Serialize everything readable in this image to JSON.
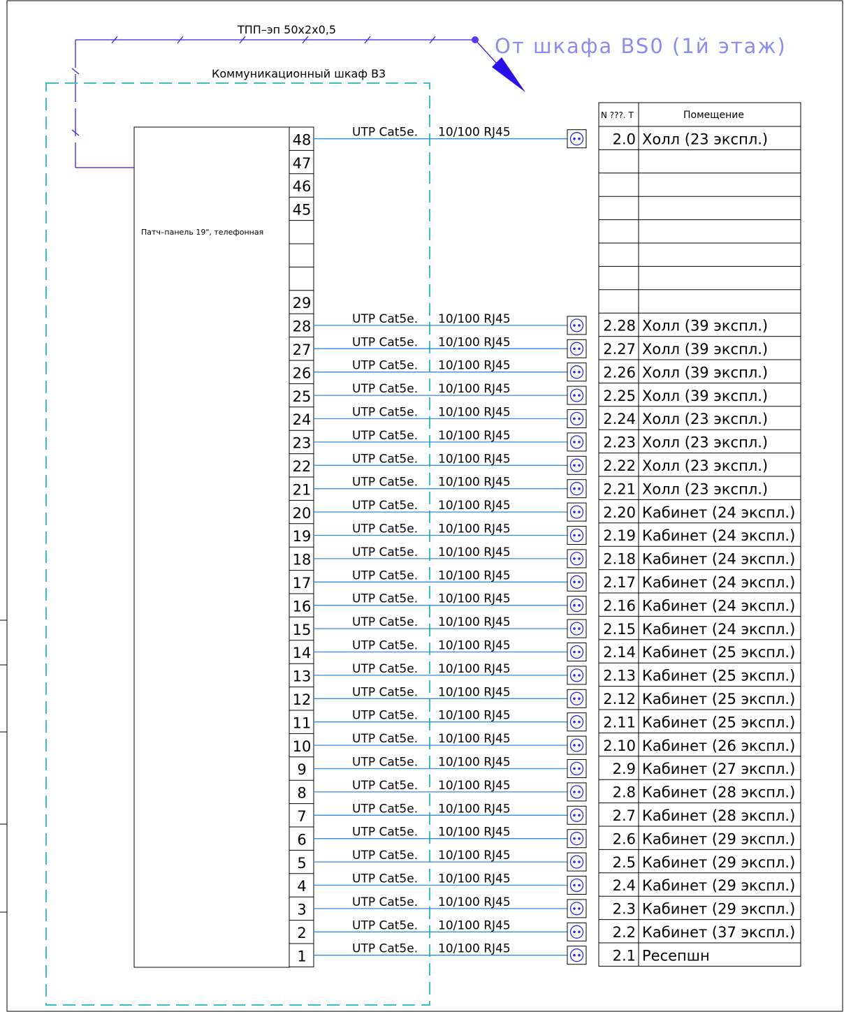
{
  "texts": {
    "trunk_cable": "ТПП–эп 50x2x0,5",
    "source": "От шкафа BS0 (1й этаж)",
    "cabinet": "Коммуникационный шкаф В3",
    "panel": "Патч–панель 19\", телефонная"
  },
  "table_headers": {
    "number": "N ???. T",
    "room": "Помещение"
  },
  "cable_label": {
    "cable": "UTP Cat5e.",
    "type": "10/100 RJ45"
  },
  "upper_ports": [
    "48",
    "47",
    "46",
    "45",
    "",
    "",
    "",
    "29"
  ],
  "rows": [
    {
      "port": "28",
      "num": "2.28",
      "room": "Холл (39 экспл.)"
    },
    {
      "port": "27",
      "num": "2.27",
      "room": "Холл (39 экспл.)"
    },
    {
      "port": "26",
      "num": "2.26",
      "room": "Холл (39 экспл.)"
    },
    {
      "port": "25",
      "num": "2.25",
      "room": "Холл (39 экспл.)"
    },
    {
      "port": "24",
      "num": "2.24",
      "room": "Холл (23 экспл.)"
    },
    {
      "port": "23",
      "num": "2.23",
      "room": "Холл (23 экспл.)"
    },
    {
      "port": "22",
      "num": "2.22",
      "room": "Холл (23 экспл.)"
    },
    {
      "port": "21",
      "num": "2.21",
      "room": "Холл (23 экспл.)"
    },
    {
      "port": "20",
      "num": "2.20",
      "room": "Кабинет (24 экспл.)"
    },
    {
      "port": "19",
      "num": "2.19",
      "room": "Кабинет (24 экспл.)"
    },
    {
      "port": "18",
      "num": "2.18",
      "room": "Кабинет (24 экспл.)"
    },
    {
      "port": "17",
      "num": "2.17",
      "room": "Кабинет (24 экспл.)"
    },
    {
      "port": "16",
      "num": "2.16",
      "room": "Кабинет (24 экспл.)"
    },
    {
      "port": "15",
      "num": "2.15",
      "room": "Кабинет (24 экспл.)"
    },
    {
      "port": "14",
      "num": "2.14",
      "room": "Кабинет (25 экспл.)"
    },
    {
      "port": "13",
      "num": "2.13",
      "room": "Кабинет (25 экспл.)"
    },
    {
      "port": "12",
      "num": "2.12",
      "room": "Кабинет (25 экспл.)"
    },
    {
      "port": "11",
      "num": "2.11",
      "room": "Кабинет (25 экспл.)"
    },
    {
      "port": "10",
      "num": "2.10",
      "room": "Кабинет (26 экспл.)"
    },
    {
      "port": "9",
      "num": "2.9",
      "room": "Кабинет (27 экспл.)"
    },
    {
      "port": "8",
      "num": "2.8",
      "room": "Кабинет (28 экспл.)"
    },
    {
      "port": "7",
      "num": "2.7",
      "room": "Кабинет (28 экспл.)"
    },
    {
      "port": "6",
      "num": "2.6",
      "room": "Кабинет (29 экспл.)"
    },
    {
      "port": "5",
      "num": "2.5",
      "room": "Кабинет (29 экспл.)"
    },
    {
      "port": "4",
      "num": "2.4",
      "room": "Кабинет (29 экспл.)"
    },
    {
      "port": "3",
      "num": "2.3",
      "room": "Кабинет (29 экспл.)"
    },
    {
      "port": "2",
      "num": "2.2",
      "room": "Кабинет (37 экспл.)"
    },
    {
      "port": "1",
      "num": "2.1",
      "room": "Ресепшн"
    }
  ],
  "top_row": {
    "port": "48",
    "num": "2.0",
    "room": "Холл (23 экспл.)"
  },
  "colors": {
    "cable_line": "#2f8fe0",
    "cabinet_border": "#3cc0c0",
    "trunk_line": "#3a22e0",
    "socket": "#2a2ad8"
  }
}
